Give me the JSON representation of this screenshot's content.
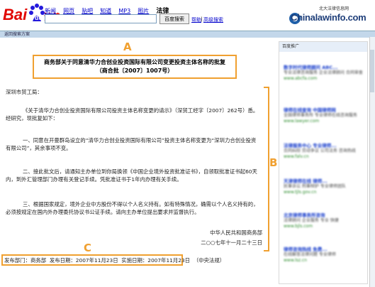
{
  "header": {
    "logo_text": "Baidu",
    "logo_sub": "法律",
    "nav": [
      "新闻",
      "网页",
      "贴吧",
      "知道",
      "MP3",
      "图片"
    ],
    "nav_current": "法律",
    "search_placeholder": "",
    "search_button": "百度搜索",
    "help": "帮助",
    "advanced": "高级搜索",
    "partner_top": "北大法律信息网",
    "partner_url": "Chinalawinfo.com"
  },
  "breadcrumb": "返回搜索方案",
  "document": {
    "title": "商务部关于同意清华力合创业投资国际有限公司变更投资主体名称的批复",
    "number": "（商合批〔2007〕1007号）",
    "salutation": "深圳市贸工局：",
    "para1": "《关于清华力合创业投资国际有限公司投资主体名称变更的请示》（深贸工经字〔2007〕262号）悉。经研究，现批复如下：",
    "para2": "一、同意在开曼群岛设立的“清华力合创业投资国际有限公司”投资主体名称变更为“深圳力合创业投资有限公司”，其余事项不变。",
    "para3": "二、接此批文后，请通知主办单位到你局换领《中国企业境外投资批准证书》，自领取批准证书起60天内，到外汇管理部门办理有关登记手续。凭批准证书于1年内办理有关手续。",
    "para4": "三、根据国家规定，境外企业中方股份不得以个人名义持有。如有特殊情况，确需以个人名义持有的，必须按规定在国内外办理委托协议书公证手续。请向主办单位提出要求并监督执行。",
    "signer": "中华人民共和国商务部",
    "date": "二○○七年十一月二十三日"
  },
  "footer": {
    "publisher_label": "发布部门：商务部",
    "publish_date": "发布日期：2007年11月23日",
    "effective_date": "实施日期：2007年11月23日",
    "source": "（中央法规）"
  },
  "annotations": {
    "a": "A",
    "b": "B",
    "c": "C"
  },
  "sidebar": {
    "header": "百度推广",
    "ads": [
      {
        "title": "数字时代律师顾问 ABC...",
        "desc": "专业法律咨询服务 企业法律顾问 合同审查",
        "url": "www.abcfa.com"
      },
      {
        "title": "律师在线查询 中国律师网",
        "desc": "全国律师事务所 专业律师在线咨询服务",
        "url": "www.lawyer.com"
      },
      {
        "title": "法律服务中心 专业律师...",
        "desc": "合同纠纷 劳动争议 公司法务 咨询热线",
        "url": "www.falv.cn"
      },
      {
        "title": "天津律师在线 律师...",
        "desc": "民事诉讼 刑事辩护 专业律师团队",
        "url": "www.tjls.gov.cn"
      },
      {
        "title": "北京律师事务所咨询",
        "desc": "法律顾问 企业服务 专业 快捷",
        "url": "www.bjls.com"
      },
      {
        "title": "律师咨询热线 免费...",
        "desc": "在线解答法律问题 专业律师",
        "url": "www.lsz.cn"
      }
    ]
  }
}
